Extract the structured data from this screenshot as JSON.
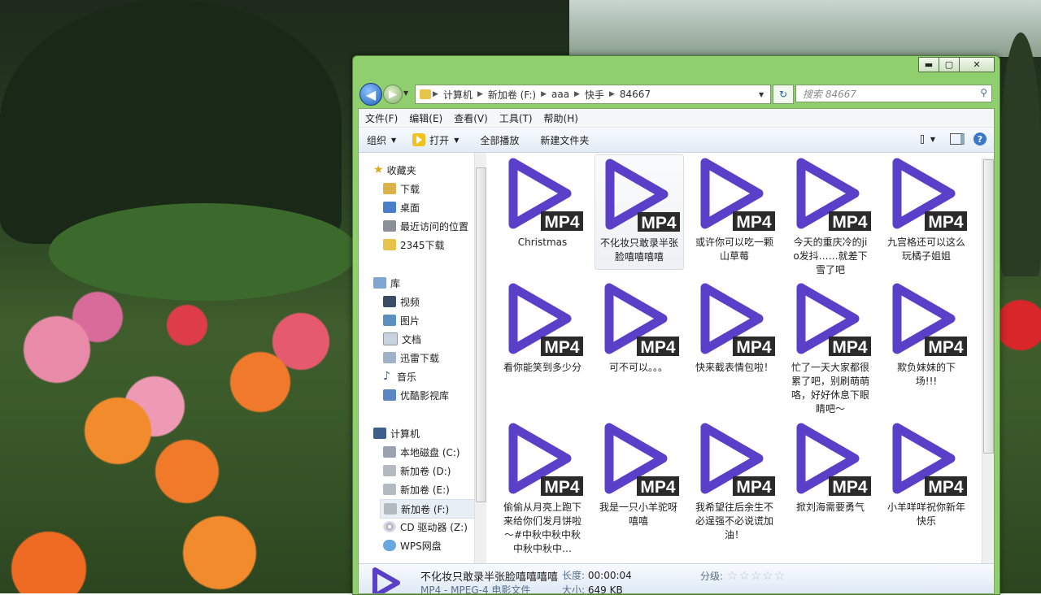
{
  "window": {
    "controls": {
      "minimize": "▬",
      "maximize": "▢",
      "close": "✕"
    }
  },
  "address_bar": {
    "segments": [
      "计算机",
      "新加卷 (F:)",
      "aaa",
      "快手",
      "84667"
    ],
    "search_placeholder": "搜索 84667"
  },
  "menu": [
    "文件(F)",
    "编辑(E)",
    "查看(V)",
    "工具(T)",
    "帮助(H)"
  ],
  "toolbar": {
    "organize": "组织",
    "open": "打开",
    "play_all": "全部播放",
    "new_folder": "新建文件夹"
  },
  "nav_pane": {
    "favorites_label": "收藏夹",
    "favorites": [
      "下载",
      "桌面",
      "最近访问的位置",
      "2345下载"
    ],
    "library_label": "库",
    "libraries": [
      "视频",
      "图片",
      "文档",
      "迅雷下载",
      "音乐",
      "优酷影视库"
    ],
    "computer_label": "计算机",
    "drives": [
      "本地磁盘 (C:)",
      "新加卷 (D:)",
      "新加卷 (E:)",
      "新加卷 (F:)",
      "CD 驱动器 (Z:)",
      "WPS网盘"
    ],
    "selected_drive": "新加卷 (F:)"
  },
  "file_badge": "MP4",
  "files": [
    {
      "name": "Christmas"
    },
    {
      "name": "不化妆只敢录半张脸嘻嘻嘻嘻"
    },
    {
      "name": "或许你可以吃一颗山草莓"
    },
    {
      "name": "今天的重庆冷的jio发抖……就差下雪了吧"
    },
    {
      "name": "九宫格还可以这么玩橘子姐姐"
    },
    {
      "name": "看你能笑到多少分"
    },
    {
      "name": "可不可以。。。"
    },
    {
      "name": "快来截表情包啦！"
    },
    {
      "name": "忙了一天大家都很累了吧，别刷萌萌咯，好好休息下眼睛吧～"
    },
    {
      "name": "欺负妹妹的下场!!!"
    },
    {
      "name": "偷偷从月亮上跑下来给你们发月饼啦～#中秋中秋中秋中秋中秋中…"
    },
    {
      "name": "我是一只小羊驼呀嘻嘻"
    },
    {
      "name": "我希望往后余生不必逞强不必说谎加油！"
    },
    {
      "name": "掀刘海需要勇气"
    },
    {
      "name": "小羊咩咩祝你新年快乐"
    }
  ],
  "details": {
    "title": "不化妆只敢录半张脸嘻嘻嘻嘻",
    "type": "MP4 - MPEG-4 电影文件",
    "length_label": "长度:",
    "length": "00:00:04",
    "size_label": "大小:",
    "size": "649 KB",
    "rating_label": "分级:",
    "rating_stars": 0
  },
  "colors": {
    "window_frame": "#8fcf6e",
    "play_icon": "#5a3fc8",
    "badge_bg": "#2b2b2b"
  }
}
